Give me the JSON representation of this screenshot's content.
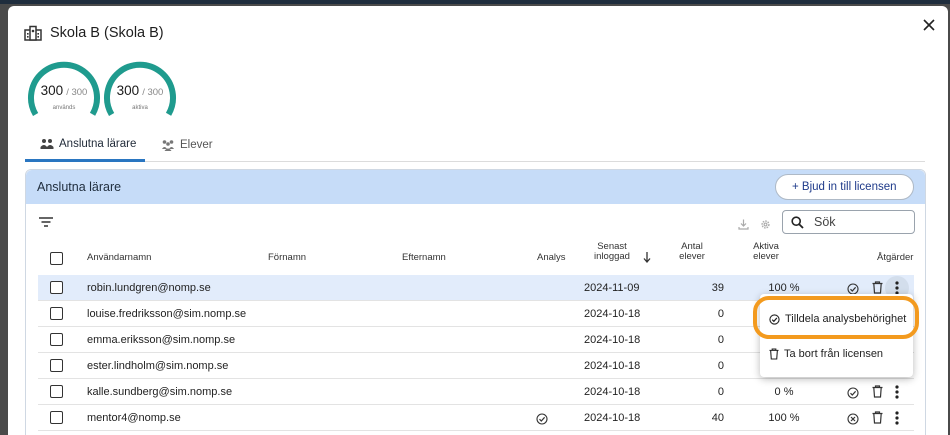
{
  "dialog": {
    "school_name": "Skola B (Skola B)",
    "close_icon": "close-icon"
  },
  "gauges": [
    {
      "value": "300",
      "max": "/ 300",
      "label": "används",
      "fraction": 1.0,
      "color": "#1f9b8e"
    },
    {
      "value": "300",
      "max": "/ 300",
      "label": "aktiva",
      "fraction": 1.0,
      "color": "#1f9b8e"
    }
  ],
  "tabs": [
    {
      "label": "Anslutna lärare",
      "active": true,
      "icon": "teachers-icon"
    },
    {
      "label": "Elever",
      "active": false,
      "icon": "students-icon"
    }
  ],
  "panel": {
    "title": "Anslutna lärare",
    "invite_button": "+ Bjud in till licensen",
    "search_placeholder": "Sök"
  },
  "columns": {
    "username": "Användarnamn",
    "firstname": "Förnamn",
    "lastname": "Efternamn",
    "analysis": "Analys",
    "last_login_1": "Senast",
    "last_login_2": "inloggad",
    "students_1": "Antal",
    "students_2": "elever",
    "active_1": "Aktiva",
    "active_2": "elever",
    "actions": "Åtgärder"
  },
  "rows": [
    {
      "username": "robin.lundgren@nomp.se",
      "last_login": "2024-11-09",
      "students": "39",
      "active": "100 %",
      "analysis": false,
      "action_icon": "check-circle-icon",
      "selected": true
    },
    {
      "username": "louise.fredriksson@sim.nomp.se",
      "last_login": "2024-10-18",
      "students": "0",
      "active": "",
      "analysis": false,
      "action_icon": "check-circle-icon",
      "selected": false
    },
    {
      "username": "emma.eriksson@sim.nomp.se",
      "last_login": "2024-10-18",
      "students": "0",
      "active": "",
      "analysis": false,
      "action_icon": "check-circle-icon",
      "selected": false
    },
    {
      "username": "ester.lindholm@sim.nomp.se",
      "last_login": "2024-10-18",
      "students": "0",
      "active": "",
      "analysis": false,
      "action_icon": "check-circle-icon",
      "selected": false
    },
    {
      "username": "kalle.sundberg@sim.nomp.se",
      "last_login": "2024-10-18",
      "students": "0",
      "active": "0 %",
      "analysis": false,
      "action_icon": "check-circle-icon",
      "selected": false
    },
    {
      "username": "mentor4@nomp.se",
      "last_login": "2024-10-18",
      "students": "40",
      "active": "100 %",
      "analysis": true,
      "action_icon": "x-circle-icon",
      "selected": false
    }
  ],
  "context_menu": {
    "items": [
      {
        "label": "Tilldela analysbehörighet",
        "icon": "check-circle-icon"
      },
      {
        "label": "Ta bort från licensen",
        "icon": "trash-icon"
      }
    ]
  },
  "colors": {
    "accent": "#2a76c1",
    "panel_header": "#c6dcf8",
    "highlight": "#f39a1e",
    "gauge": "#1f9b8e"
  }
}
